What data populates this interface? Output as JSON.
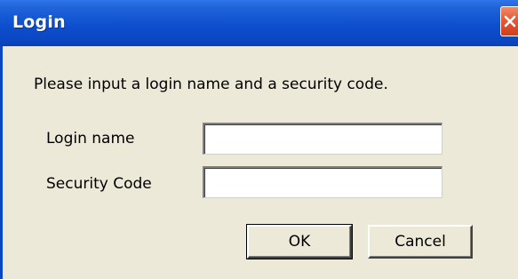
{
  "window": {
    "title": "Login",
    "close_icon": "close-icon"
  },
  "dialog": {
    "prompt": "Please input a login name and a security code.",
    "login_name": {
      "label": "Login name",
      "value": ""
    },
    "security_code": {
      "label": "Security Code",
      "value": ""
    },
    "ok_label": "OK",
    "cancel_label": "Cancel"
  },
  "colors": {
    "titlebar": "#0b47c4",
    "client_background": "#ece9d8",
    "close_button": "#e25a36"
  }
}
